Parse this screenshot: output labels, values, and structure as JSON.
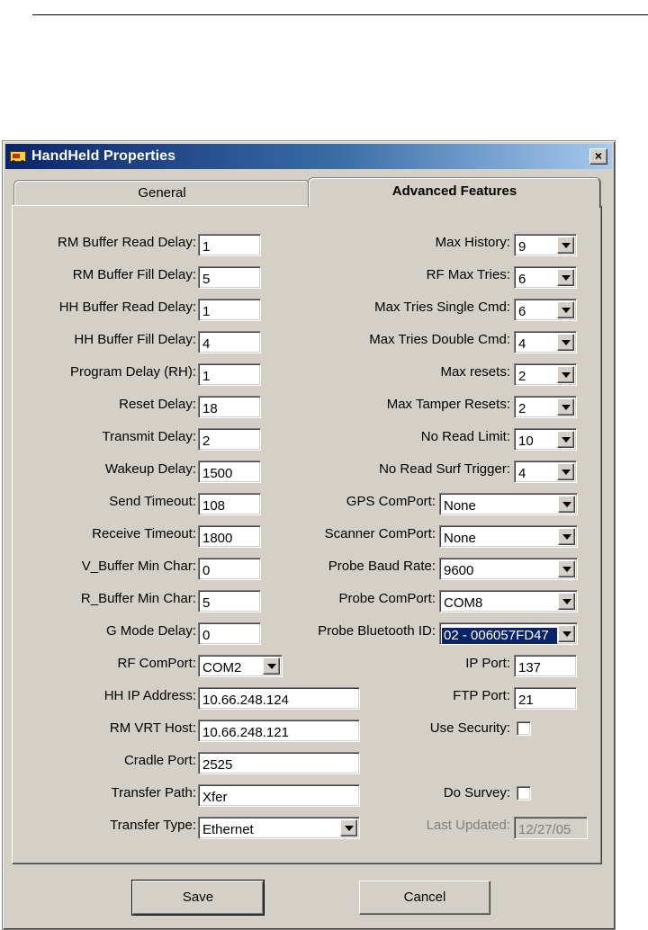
{
  "window": {
    "title": "HandHeld Properties",
    "close_glyph": "×"
  },
  "tabs": {
    "general": "General",
    "advanced": "Advanced Features",
    "active": "Advanced Features"
  },
  "left": {
    "rm_buffer_read_delay": {
      "label": "RM Buffer Read Delay:",
      "value": "1"
    },
    "rm_buffer_fill_delay": {
      "label": "RM Buffer Fill Delay:",
      "value": "5"
    },
    "hh_buffer_read_delay": {
      "label": "HH Buffer Read Delay:",
      "value": "1"
    },
    "hh_buffer_fill_delay": {
      "label": "HH Buffer Fill Delay:",
      "value": "4"
    },
    "program_delay": {
      "label": "Program Delay (RH):",
      "value": "1"
    },
    "reset_delay": {
      "label": "Reset Delay:",
      "value": "18"
    },
    "transmit_delay": {
      "label": "Transmit Delay:",
      "value": "2"
    },
    "wakeup_delay": {
      "label": "Wakeup Delay:",
      "value": "1500"
    },
    "send_timeout": {
      "label": "Send Timeout:",
      "value": "108"
    },
    "receive_timeout": {
      "label": "Receive Timeout:",
      "value": "1800"
    },
    "v_buffer_min_char": {
      "label": "V_Buffer Min Char:",
      "value": "0"
    },
    "r_buffer_min_char": {
      "label": "R_Buffer Min Char:",
      "value": "5"
    },
    "g_mode_delay": {
      "label": "G Mode Delay:",
      "value": "0"
    },
    "rf_comport": {
      "label": "RF ComPort:",
      "value": "COM2"
    },
    "hh_ip_address": {
      "label": "HH IP Address:",
      "value": "10.66.248.124"
    },
    "rm_vrt_host": {
      "label": "RM VRT Host:",
      "value": "10.66.248.121"
    },
    "cradle_port": {
      "label": "Cradle Port:",
      "value": "2525"
    },
    "transfer_path": {
      "label": "Transfer Path:",
      "value": "Xfer"
    },
    "transfer_type": {
      "label": "Transfer Type:",
      "value": "Ethernet"
    }
  },
  "right": {
    "max_history": {
      "label": "Max History:",
      "value": "9"
    },
    "rf_max_tries": {
      "label": "RF Max Tries:",
      "value": "6"
    },
    "max_tries_single_cmd": {
      "label": "Max Tries Single Cmd:",
      "value": "6"
    },
    "max_tries_double_cmd": {
      "label": "Max Tries Double Cmd:",
      "value": "4"
    },
    "max_resets": {
      "label": "Max resets:",
      "value": "2"
    },
    "max_tamper_resets": {
      "label": "Max Tamper Resets:",
      "value": "2"
    },
    "no_read_limit": {
      "label": "No Read Limit:",
      "value": "10"
    },
    "no_read_surf_trigger": {
      "label": "No Read Surf Trigger:",
      "value": "4"
    },
    "gps_comport": {
      "label": "GPS ComPort:",
      "value": "None"
    },
    "scanner_comport": {
      "label": "Scanner ComPort:",
      "value": "None"
    },
    "probe_baud_rate": {
      "label": "Probe Baud Rate:",
      "value": "9600"
    },
    "probe_comport": {
      "label": "Probe ComPort:",
      "value": "COM8"
    },
    "probe_bluetooth_id": {
      "label": "Probe Bluetooth ID:",
      "value": "02 - 006057FD47"
    },
    "ip_port": {
      "label": "IP Port:",
      "value": "137"
    },
    "ftp_port": {
      "label": "FTP Port:",
      "value": "21"
    },
    "use_security": {
      "label": "Use Security:",
      "checked": false
    },
    "do_survey": {
      "label": "Do Survey:",
      "checked": false
    },
    "last_updated": {
      "label": "Last Updated:",
      "value": "12/27/05"
    }
  },
  "buttons": {
    "save": "Save",
    "cancel": "Cancel"
  }
}
